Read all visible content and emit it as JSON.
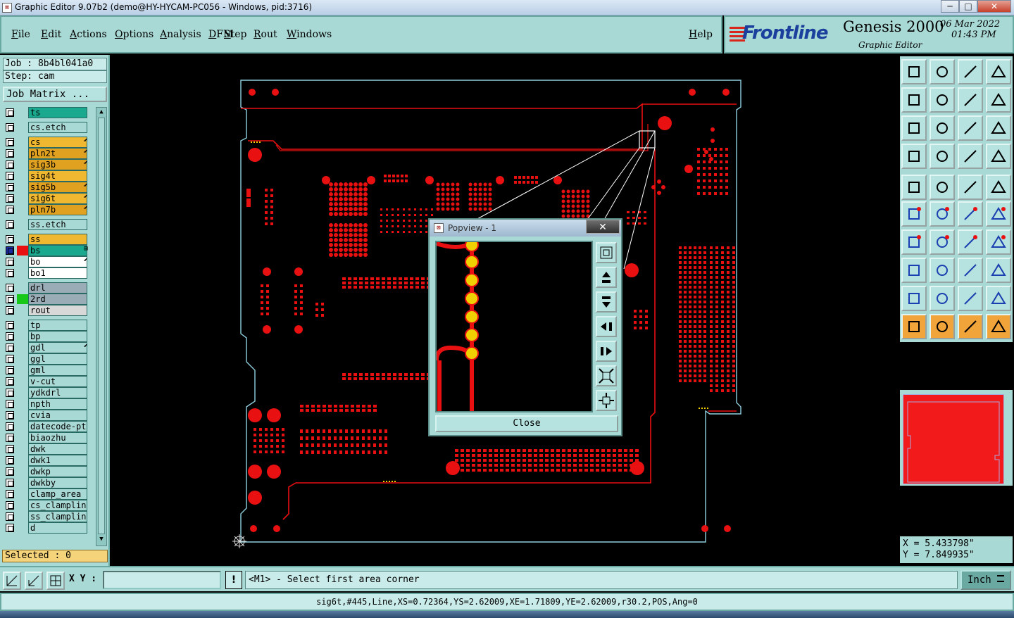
{
  "window": {
    "title": "Graphic Editor 9.07b2 (demo@HY-HYCAM-PC056 - Windows, pid:3716)",
    "min": "─",
    "max": "□",
    "close": "✕"
  },
  "menu": {
    "items": [
      "File",
      "Edit",
      "Actions",
      "Options",
      "Analysis",
      "DFM",
      "Step",
      "Rout",
      "Windows"
    ],
    "help": "Help"
  },
  "brand": {
    "logo": "Frontline",
    "product": "Genesis 2000",
    "subtitle": "Graphic Editor",
    "date": "06 Mar 2022",
    "time": "01:43 PM"
  },
  "job": {
    "job_label": "Job : 8b4bl041a0",
    "step_label": "Step: cam",
    "matrix_button": "Job Matrix ..."
  },
  "layers": [
    {
      "name": "ts",
      "bg": "#1aa88e",
      "color": "",
      "mark": ""
    },
    {
      "name": "cs.etch",
      "bg": "#a8d9d5",
      "color": "",
      "mark": ""
    },
    {
      "name": "cs",
      "bg": "#f0b830",
      "color": "",
      "mark": "⬋"
    },
    {
      "name": "pln2t",
      "bg": "#e0a020",
      "color": "",
      "mark": "⬋"
    },
    {
      "name": "sig3b",
      "bg": "#e0a020",
      "color": "",
      "mark": "⬋"
    },
    {
      "name": "sig4t",
      "bg": "#f0b830",
      "color": "",
      "mark": ""
    },
    {
      "name": "sig5b",
      "bg": "#e0a020",
      "color": "",
      "mark": "⬋"
    },
    {
      "name": "sig6t",
      "bg": "#f0b830",
      "color": "",
      "mark": "⬋"
    },
    {
      "name": "pln7b",
      "bg": "#e0a020",
      "color": "",
      "mark": "⬋"
    },
    {
      "name": "ss.etch",
      "bg": "#a8d9d5",
      "color": "",
      "mark": ""
    },
    {
      "name": "ss",
      "bg": "#f0b830",
      "color": "",
      "mark": ""
    },
    {
      "name": "bs",
      "bg": "#1aa88e",
      "color": "#e81010",
      "mark": "⊞"
    },
    {
      "name": "bo",
      "bg": "#ffffff",
      "color": "",
      "mark": "⬋"
    },
    {
      "name": "bo1",
      "bg": "#ffffff",
      "color": "",
      "mark": ""
    },
    {
      "name": "drl",
      "bg": "#9aacb6",
      "color": "",
      "mark": ""
    },
    {
      "name": "2rd",
      "bg": "#9aacb6",
      "color": "#18c818",
      "mark": ""
    },
    {
      "name": "rout",
      "bg": "#d8d8d8",
      "color": "",
      "mark": ""
    },
    {
      "name": "tp",
      "bg": "#a8d9d5",
      "color": "",
      "mark": ""
    },
    {
      "name": "bp",
      "bg": "#a8d9d5",
      "color": "",
      "mark": ""
    },
    {
      "name": "gdl",
      "bg": "#a8d9d5",
      "color": "",
      "mark": "⬋"
    },
    {
      "name": "ggl",
      "bg": "#a8d9d5",
      "color": "",
      "mark": ""
    },
    {
      "name": "gml",
      "bg": "#a8d9d5",
      "color": "",
      "mark": ""
    },
    {
      "name": "v-cut",
      "bg": "#a8d9d5",
      "color": "",
      "mark": ""
    },
    {
      "name": "ydkdrl",
      "bg": "#a8d9d5",
      "color": "",
      "mark": ""
    },
    {
      "name": "npth",
      "bg": "#a8d9d5",
      "color": "",
      "mark": ""
    },
    {
      "name": "cvia",
      "bg": "#a8d9d5",
      "color": "",
      "mark": ""
    },
    {
      "name": "datecode-pts",
      "bg": "#a8d9d5",
      "color": "",
      "mark": ""
    },
    {
      "name": "biaozhu",
      "bg": "#a8d9d5",
      "color": "",
      "mark": ""
    },
    {
      "name": "dwk",
      "bg": "#a8d9d5",
      "color": "",
      "mark": ""
    },
    {
      "name": "dwk1",
      "bg": "#a8d9d5",
      "color": "",
      "mark": ""
    },
    {
      "name": "dwkp",
      "bg": "#a8d9d5",
      "color": "",
      "mark": ""
    },
    {
      "name": "dwkby",
      "bg": "#a8d9d5",
      "color": "",
      "mark": ""
    },
    {
      "name": "clamp_area",
      "bg": "#a8d9d5",
      "color": "",
      "mark": ""
    },
    {
      "name": "cs_clampline",
      "bg": "#a8d9d5",
      "color": "",
      "mark": ""
    },
    {
      "name": "ss_clampline",
      "bg": "#a8d9d5",
      "color": "",
      "mark": ""
    },
    {
      "name": "d",
      "bg": "#a8d9d5",
      "color": "",
      "mark": ""
    }
  ],
  "selected": "Selected : 0",
  "popview": {
    "title": "Popview - 1",
    "close_x": "✕",
    "close_button": "Close"
  },
  "coords": {
    "x": "X = 5.433798\"",
    "y": "Y = 7.849935\""
  },
  "bottom": {
    "xy_label": "X Y :",
    "xy_value": "",
    "warn": "!",
    "prompt": "<M1> - Select first area corner",
    "units": "Inch"
  },
  "status": "sig6t,#445,Line,XS=0.72364,YS=2.62009,XE=1.71809,YE=2.62009,r30.2,POS,Ang=0",
  "colors": {
    "panel": "#a8d9d5",
    "copper": "#e81010",
    "outline": "#8fd0e0",
    "highlight": "#f0d000"
  }
}
